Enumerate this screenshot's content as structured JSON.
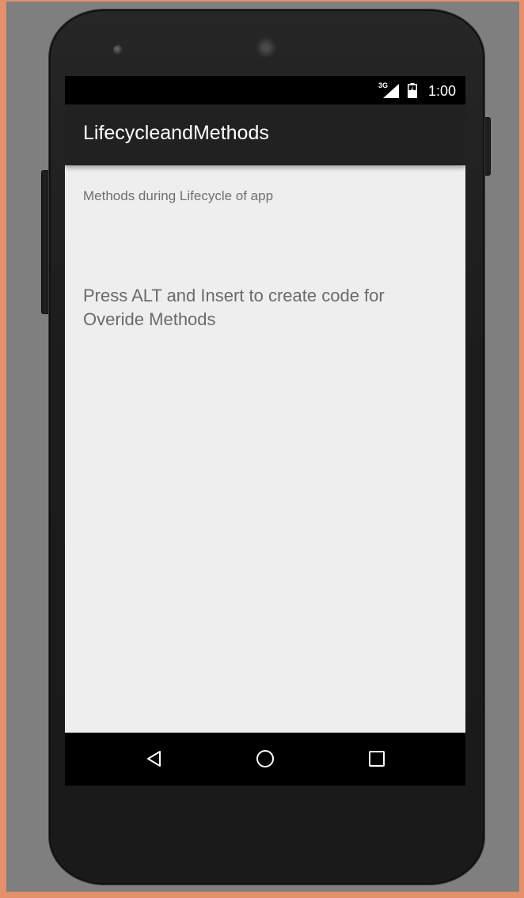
{
  "status_bar": {
    "network_type": "3G",
    "time": "1:00"
  },
  "app_bar": {
    "title": "LifecycleandMethods"
  },
  "content": {
    "heading_text": "Methods during Lifecycle of app",
    "body_text": "Press ALT and Insert to create code for Overide Methods"
  },
  "navigation": {
    "back_icon": "back-triangle-icon",
    "home_icon": "home-circle-icon",
    "recents_icon": "recents-square-icon"
  },
  "colors": {
    "frame_border": "#e3906b",
    "background": "#7f7f7f",
    "app_bar": "#212121",
    "screen_bg": "#eeeeee",
    "text_secondary": "#6f6f6f"
  }
}
